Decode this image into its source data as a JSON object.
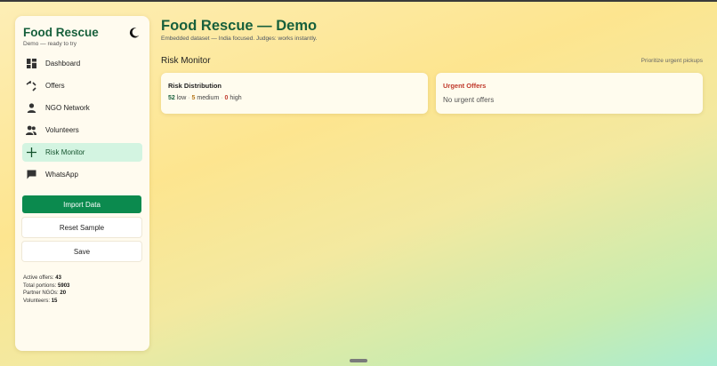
{
  "sidebar": {
    "brand": "Food Rescue",
    "brand_sub": "Demo — ready to try",
    "theme_icon": "moon-icon",
    "items": [
      {
        "label": "Dashboard",
        "icon": "dashboard-icon"
      },
      {
        "label": "Offers",
        "icon": "offers-icon"
      },
      {
        "label": "NGO Network",
        "icon": "person-icon"
      },
      {
        "label": "Volunteers",
        "icon": "people-icon"
      },
      {
        "label": "Risk Monitor",
        "icon": "plus-icon",
        "active": true
      },
      {
        "label": "WhatsApp",
        "icon": "chat-icon"
      }
    ],
    "buttons": {
      "import": "Import Data",
      "reset": "Reset Sample",
      "save": "Save"
    },
    "stats": [
      {
        "label": "Active offers:",
        "value": "43"
      },
      {
        "label": "Total portions:",
        "value": "5903"
      },
      {
        "label": "Partner NGOs:",
        "value": "20"
      },
      {
        "label": "Volunteers:",
        "value": "15"
      }
    ]
  },
  "header": {
    "title": "Food Rescue — Demo",
    "subtitle": "Embedded dataset — India focused. Judges: works instantly."
  },
  "section": {
    "title": "Risk Monitor",
    "hint": "Prioritize urgent pickups"
  },
  "risk_card": {
    "title": "Risk Distribution",
    "low_count": "52",
    "low_label": "low",
    "medium_count": "5",
    "medium_label": "medium",
    "high_count": "0",
    "high_label": "high",
    "separator": "·"
  },
  "urgent_card": {
    "title": "Urgent Offers",
    "empty": "No urgent offers"
  },
  "colors": {
    "brand": "#17603c",
    "primary_button": "#0b8a4e",
    "active_nav": "#d3f4e1",
    "urgent": "#c0392b",
    "medium": "#b7791f"
  }
}
